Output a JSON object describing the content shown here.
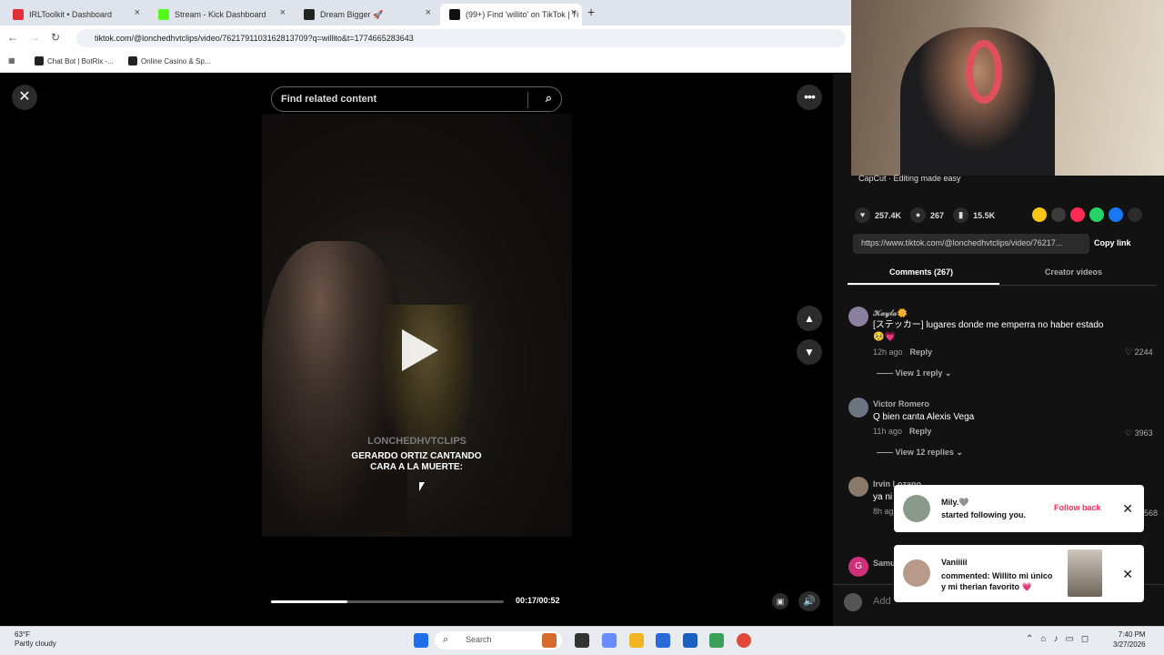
{
  "browser": {
    "tabs": [
      {
        "label": "IRLToolkit • Dashboard",
        "favicon_color": "#e0303a",
        "active": false
      },
      {
        "label": "Stream - Kick Dashboard",
        "favicon_color": "#53fc18",
        "active": false
      },
      {
        "label": "Dream Bigger 🚀",
        "favicon_color": "#222222",
        "active": false
      },
      {
        "label": "(99+) Find 'willito' on TikTok | Ti",
        "favicon_color": "#111111",
        "active": true
      }
    ],
    "new_tab_symbol": "+",
    "url": "tiktok.com/@lonchedhvtclips/video/7621791103162813709?q=willito&t=1774665283643",
    "bookmarks": [
      "Chat Bot | BotRix -...",
      "Online Casino & Sp..."
    ]
  },
  "player": {
    "search_placeholder": "Find related content",
    "watermark": "LONCHEDHVTCLIPS",
    "caption_line1": "GERARDO ORTIZ CANTANDO",
    "caption_line2": "CARA A LA MUERTE:",
    "time": "00:17/00:52",
    "progress_fraction": 0.33
  },
  "panel": {
    "ad_text": "CapCut · Editing made easy",
    "likes": "257.4K",
    "comments_count": "267",
    "saves": "15.5K",
    "share_colors": [
      "#f5c518",
      "#3a3a3a",
      "#fe2c55",
      "#25d366",
      "#1877f2",
      "#2b2b2b"
    ],
    "share_link": "https://www.tiktok.com/@lonchedhvtclips/video/76217...",
    "copy_link": "Copy link",
    "tab_comments": "Comments (267)",
    "tab_creator": "Creator videos",
    "comments": [
      {
        "user": "𝒦𝒶𝓎𝓁𝒶🌼",
        "text": "[ステッカー] lugares donde me emperra no haber estado",
        "text2": "🥺💗",
        "time": "12h ago",
        "reply": "Reply",
        "likes": "2244",
        "view_replies": "View 1 reply"
      },
      {
        "user": "Victor Romero",
        "text": "Q bien canta Alexis Vega",
        "time": "11h ago",
        "reply": "Reply",
        "likes": "3963",
        "view_replies": "View 12 replies"
      },
      {
        "user": "Irvin Lozano",
        "text": "ya ni",
        "time": "8h ag",
        "likes": "568"
      },
      {
        "user": "Samu",
        "avatar_letter": "G"
      }
    ],
    "add_comment_placeholder": "Add"
  },
  "notifications": [
    {
      "name": "Mily.🩶",
      "text": "started following you.",
      "action": "Follow back"
    },
    {
      "name": "Vaniiiii",
      "text_line1": "commented: Willito mi único",
      "text_line2": "y mi therian favorito 💗"
    }
  ],
  "taskbar": {
    "weather_temp": "63°F",
    "weather_desc": "Partly cloudy",
    "search_label": "Search",
    "time": "7:40 PM",
    "date": "3/27/2026"
  }
}
